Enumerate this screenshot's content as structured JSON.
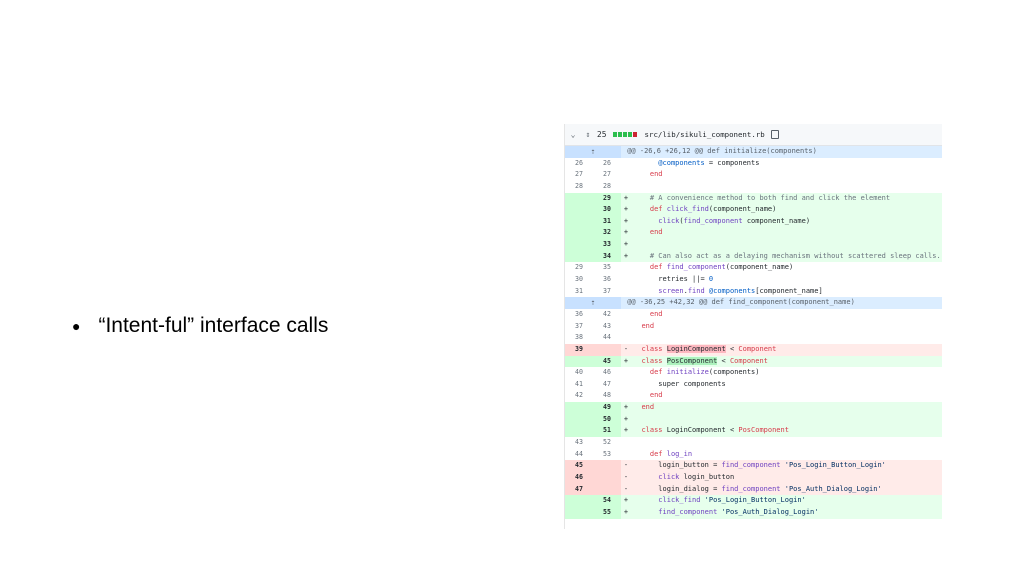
{
  "slide": {
    "bullet_text": "“Intent-ful” interface calls"
  },
  "diff": {
    "header": {
      "change_count": "25",
      "file_path": "src/lib/sikuli_component.rb",
      "bar_colors": [
        "#2cbe4e",
        "#2cbe4e",
        "#2cbe4e",
        "#2cbe4e",
        "#cb2431"
      ]
    },
    "lines": [
      {
        "type": "hunk",
        "text": "@@ -26,6 +26,12 @@ def initialize(components)"
      },
      {
        "type": "ctx",
        "old": "26",
        "new": "26",
        "sign": "",
        "tokens": [
          {
            "t": "    "
          },
          {
            "t": "@components",
            "c": "ivar"
          },
          {
            "t": " = components"
          }
        ]
      },
      {
        "type": "ctx",
        "old": "27",
        "new": "27",
        "sign": "",
        "tokens": [
          {
            "t": "  "
          },
          {
            "t": "end",
            "c": "kw"
          }
        ]
      },
      {
        "type": "ctx",
        "old": "28",
        "new": "28",
        "sign": "",
        "tokens": []
      },
      {
        "type": "add",
        "old": "",
        "new": "29",
        "sign": "+",
        "tokens": [
          {
            "t": "  "
          },
          {
            "t": "# A convenience method to both find and click the element",
            "c": "cmt"
          }
        ]
      },
      {
        "type": "add",
        "old": "",
        "new": "30",
        "sign": "+",
        "tokens": [
          {
            "t": "  "
          },
          {
            "t": "def",
            "c": "kw"
          },
          {
            "t": " "
          },
          {
            "t": "click_find",
            "c": "fn"
          },
          {
            "t": "(component_name)"
          }
        ]
      },
      {
        "type": "add",
        "old": "",
        "new": "31",
        "sign": "+",
        "tokens": [
          {
            "t": "    "
          },
          {
            "t": "click",
            "c": "fn"
          },
          {
            "t": "("
          },
          {
            "t": "find_component",
            "c": "fn"
          },
          {
            "t": " component_name)"
          }
        ]
      },
      {
        "type": "add",
        "old": "",
        "new": "32",
        "sign": "+",
        "tokens": [
          {
            "t": "  "
          },
          {
            "t": "end",
            "c": "kw"
          }
        ]
      },
      {
        "type": "add",
        "old": "",
        "new": "33",
        "sign": "+",
        "tokens": []
      },
      {
        "type": "add",
        "old": "",
        "new": "34",
        "sign": "+",
        "tokens": [
          {
            "t": "  "
          },
          {
            "t": "# Can also act as a delaying mechanism without scattered sleep calls.",
            "c": "cmt"
          }
        ]
      },
      {
        "type": "ctx",
        "old": "29",
        "new": "35",
        "sign": "",
        "tokens": [
          {
            "t": "  "
          },
          {
            "t": "def",
            "c": "kw"
          },
          {
            "t": " "
          },
          {
            "t": "find_component",
            "c": "fn"
          },
          {
            "t": "(component_name)"
          }
        ]
      },
      {
        "type": "ctx",
        "old": "30",
        "new": "36",
        "sign": "",
        "tokens": [
          {
            "t": "    retries ||= "
          },
          {
            "t": "0",
            "c": "num"
          }
        ]
      },
      {
        "type": "ctx",
        "old": "31",
        "new": "37",
        "sign": "",
        "tokens": [
          {
            "t": "    "
          },
          {
            "t": "screen",
            "c": "fn"
          },
          {
            "t": "."
          },
          {
            "t": "find",
            "c": "fn"
          },
          {
            "t": " "
          },
          {
            "t": "@components",
            "c": "ivar"
          },
          {
            "t": "[component_name]"
          }
        ]
      },
      {
        "type": "hunk",
        "text": "@@ -36,25 +42,32 @@ def find_component(component_name)"
      },
      {
        "type": "ctx",
        "old": "36",
        "new": "42",
        "sign": "",
        "tokens": [
          {
            "t": "  "
          },
          {
            "t": "end",
            "c": "kw"
          }
        ]
      },
      {
        "type": "ctx",
        "old": "37",
        "new": "43",
        "sign": "",
        "tokens": [
          {
            "t": "end",
            "c": "kw"
          }
        ]
      },
      {
        "type": "ctx",
        "old": "38",
        "new": "44",
        "sign": "",
        "tokens": []
      },
      {
        "type": "del",
        "old": "39",
        "new": "",
        "sign": "-",
        "tokens": [
          {
            "t": "class",
            "c": "kw"
          },
          {
            "t": " "
          },
          {
            "t": "LoginComponent",
            "c": "hl-del"
          },
          {
            "t": " < "
          },
          {
            "t": "Component",
            "c": "kw"
          }
        ]
      },
      {
        "type": "add",
        "old": "",
        "new": "45",
        "sign": "+",
        "tokens": [
          {
            "t": "class",
            "c": "kw"
          },
          {
            "t": " "
          },
          {
            "t": "PosComponent",
            "c": "hl-add"
          },
          {
            "t": " < "
          },
          {
            "t": "Component",
            "c": "kw"
          }
        ]
      },
      {
        "type": "ctx",
        "old": "40",
        "new": "46",
        "sign": "",
        "tokens": [
          {
            "t": "  "
          },
          {
            "t": "def",
            "c": "kw"
          },
          {
            "t": " "
          },
          {
            "t": "initialize",
            "c": "fn"
          },
          {
            "t": "(components)"
          }
        ]
      },
      {
        "type": "ctx",
        "old": "41",
        "new": "47",
        "sign": "",
        "tokens": [
          {
            "t": "    super components"
          }
        ]
      },
      {
        "type": "ctx",
        "old": "42",
        "new": "48",
        "sign": "",
        "tokens": [
          {
            "t": "  "
          },
          {
            "t": "end",
            "c": "kw"
          }
        ]
      },
      {
        "type": "add",
        "old": "",
        "new": "49",
        "sign": "+",
        "tokens": [
          {
            "t": "end",
            "c": "kw"
          }
        ]
      },
      {
        "type": "add",
        "old": "",
        "new": "50",
        "sign": "+",
        "tokens": []
      },
      {
        "type": "add",
        "old": "",
        "new": "51",
        "sign": "+",
        "tokens": [
          {
            "t": "class",
            "c": "kw"
          },
          {
            "t": " LoginComponent < "
          },
          {
            "t": "PosComponent",
            "c": "kw"
          }
        ]
      },
      {
        "type": "ctx",
        "old": "43",
        "new": "52",
        "sign": "",
        "tokens": []
      },
      {
        "type": "ctx",
        "old": "44",
        "new": "53",
        "sign": "",
        "tokens": [
          {
            "t": "  "
          },
          {
            "t": "def",
            "c": "kw"
          },
          {
            "t": " "
          },
          {
            "t": "log_in",
            "c": "fn"
          }
        ]
      },
      {
        "type": "del",
        "old": "45",
        "new": "",
        "sign": "-",
        "tokens": [
          {
            "t": "    login_button = "
          },
          {
            "t": "find_component",
            "c": "fn"
          },
          {
            "t": " "
          },
          {
            "t": "'Pos_Login_Button_Login'",
            "c": "str"
          }
        ]
      },
      {
        "type": "del",
        "old": "46",
        "new": "",
        "sign": "-",
        "tokens": [
          {
            "t": "    "
          },
          {
            "t": "click",
            "c": "fn"
          },
          {
            "t": " login_button"
          }
        ]
      },
      {
        "type": "del",
        "old": "47",
        "new": "",
        "sign": "-",
        "tokens": [
          {
            "t": "    login_dialog = "
          },
          {
            "t": "find_component",
            "c": "fn"
          },
          {
            "t": " "
          },
          {
            "t": "'Pos_Auth_Dialog_Login'",
            "c": "str"
          }
        ]
      },
      {
        "type": "add",
        "old": "",
        "new": "54",
        "sign": "+",
        "tokens": [
          {
            "t": "    "
          },
          {
            "t": "click_find",
            "c": "fn"
          },
          {
            "t": " "
          },
          {
            "t": "'Pos_Login_Button_Login'",
            "c": "str"
          }
        ]
      },
      {
        "type": "add",
        "old": "",
        "new": "55",
        "sign": "+",
        "tokens": [
          {
            "t": "    "
          },
          {
            "t": "find_component",
            "c": "fn"
          },
          {
            "t": " "
          },
          {
            "t": "'Pos_Auth_Dialog_Login'",
            "c": "str"
          }
        ]
      }
    ]
  }
}
